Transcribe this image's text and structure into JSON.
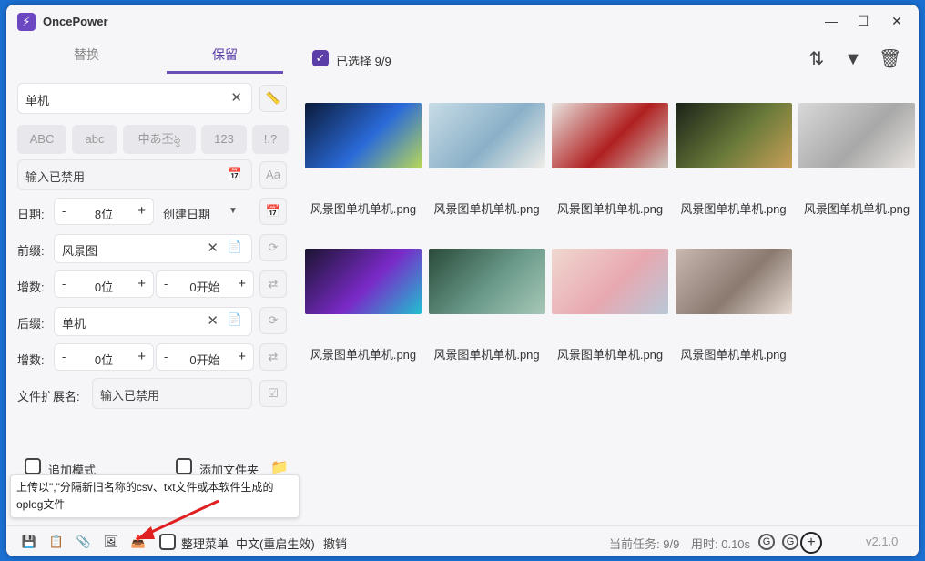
{
  "titlebar": {
    "title": "OncePower",
    "logo": "⚡",
    "minimize": "—",
    "maximize": "☐",
    "close": "✕"
  },
  "tabs": [
    {
      "label": "替换"
    },
    {
      "label": "保留"
    }
  ],
  "keep_input": {
    "value": "单机",
    "ruler_icon": "ruler-icon"
  },
  "chips": [
    "ABC",
    "abc",
    "中あ丕ৡ",
    "123",
    "!.?"
  ],
  "disabled_input": {
    "placeholder": "输入已禁用",
    "calendar_icon": "calendar-icon",
    "font_btn": "Aa"
  },
  "date_row": {
    "label": "日期:",
    "minus": "-",
    "value": "8位",
    "plus": "+",
    "type": "创建日期",
    "arrow": "▼"
  },
  "prefix": {
    "label": "前缀:",
    "value": "风景图"
  },
  "prefix_inc": {
    "label": "增数:",
    "minus1": "-",
    "value1": "0位",
    "plus1": "+",
    "minus2": "-",
    "value2": "0开始",
    "plus2": "+"
  },
  "suffix": {
    "label": "后缀:",
    "value": "单机"
  },
  "suffix_inc": {
    "label": "增数:",
    "minus1": "-",
    "value1": "0位",
    "plus1": "+",
    "minus2": "-",
    "value2": "0开始",
    "plus2": "+"
  },
  "ext": {
    "label": "文件扩展名:",
    "placeholder": "输入已禁用"
  },
  "options": {
    "append_mode": "追加模式",
    "add_folder": "添加文件夹"
  },
  "tooltip": "上传以\",\"分隔新旧名称的csv、txt文件或本软件生成的oplog文件",
  "toolbar": {
    "selected": "已选择 9/9"
  },
  "files": [
    {
      "name": "风景图单机单机.png",
      "colors": [
        "#0b1a3a",
        "#2a6ad8",
        "#b8d858"
      ]
    },
    {
      "name": "风景图单机单机.png",
      "colors": [
        "#c8dce6",
        "#8ab0c8",
        "#f0eee8"
      ]
    },
    {
      "name": "风景图单机单机.png",
      "colors": [
        "#e8e4e0",
        "#b02020",
        "#d0cac4"
      ]
    },
    {
      "name": "风景图单机单机.png",
      "colors": [
        "#1a2218",
        "#6a7a3a",
        "#c8a058"
      ]
    },
    {
      "name": "风景图单机单机.png",
      "colors": [
        "#d8d8d8",
        "#a8a8a8",
        "#e8e4e0"
      ]
    },
    {
      "name": "风景图单机单机.png",
      "colors": [
        "#1a1430",
        "#7a2ac8",
        "#20c0d0"
      ]
    },
    {
      "name": "风景图单机单机.png",
      "colors": [
        "#2a4a3a",
        "#6a9a8a",
        "#a8c8b8"
      ]
    },
    {
      "name": "风景图单机单机.png",
      "colors": [
        "#f0d8d0",
        "#e8a8b0",
        "#b8c8d8"
      ]
    },
    {
      "name": "风景图单机单机.png",
      "colors": [
        "#c8b8b0",
        "#8a7a70",
        "#e8dcd4"
      ]
    }
  ],
  "statusbar": {
    "organize_menu": "整理菜单",
    "language": "中文(重启生效)",
    "undo": "撤销",
    "task": "当前任务: 9/9",
    "time": "用时: 0.10s",
    "version": "v2.1.0"
  },
  "colors": {
    "accent": "#5b3ea8",
    "background": "#f6f6f8",
    "desktop": "#1a6fd1"
  }
}
